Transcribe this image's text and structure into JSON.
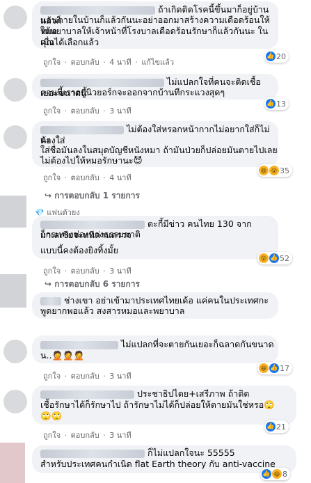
{
  "meta": {
    "like": "ถูกใจ",
    "reply": "ตอบกลับ",
    "sep": "·"
  },
  "comments": [
    {
      "text1": "ถ้าเกิดติดโรคนี้ขึ้นมาก็อยู่บ้านแล้วก็",
      "text2": "นอนตายในบ้านก็แล้วกันนะอย่าออกมาสร้างความเดือดร้อนให้หมอ",
      "text3": "ให้พยาบาลให้เจ้าหน้าที่โรงบาลเดือดร้อนรักษาก็แล้วกันนะ ในเมื่อ",
      "text4": "คุณได้เลือกแล้ว",
      "time": "4 นาที",
      "extra": "แก้ไขแล้ว",
      "count": "20"
    },
    {
      "text1": "ไม่แปลกใจที่คนจะติดเชื้อเยอะขนาดนี้",
      "text2": "ตอนนี้เราอยู่นิวยอร์กจะออกจากบ้านทีกระแวงสุดๆ",
      "time": "3 นาที",
      "count": "13"
    },
    {
      "text1": "ไม่ต้องใส่หรอกหน้ากากไม่อยากใส่ก็ไม่ต้องใส่",
      "text2": "นะ",
      "text3": "ใส่ชื่อมันลงในสมุดบัญชีหนังหมา ถ้ามันป่วยก็ปล่อยมันตายไปเลย",
      "text4": "ไม่ต้องไปให้หมอรักษานะ😈",
      "time": "4 นาที",
      "count": "35",
      "replies": "การตอบกลับ 1 รายการ"
    },
    {
      "fan": "แฟนตัวยง",
      "text1": "ตะกี้มีข่าว คนไทย 130 จากมาเลเซียจะหนีด่านตรวจ",
      "text2": "ก็กรเทางช่องทางธรรมชาติ",
      "text3": "แบบนี้คงต้องยิงทิ้งมั้ย",
      "time": "3 นาที",
      "count": "52",
      "replies": "การตอบกลับ 6 รายการ"
    },
    {
      "text1": "ช่างเขา อย่าเข้ามาประเทศไทยเด้อ แค่คนในประเทศกะ",
      "text2": "พูดยากพอแล้ว สงสารหมอและพยาบาล"
    },
    {
      "text1": "ไม่แปลกที่จะตายกันเยอะก็ฉลาดกันขนาด",
      "text2": "น..🤦🤦🤦",
      "time": "3 นาที",
      "count": "17"
    },
    {
      "text1": "ประชาธิปไตย+เสรีภาพ ถ้าติด",
      "text2": "เชื้อรักษาได้ก็รักษาไป ถ้ารักษาไม่ได้ก็ปล่อยให้ตายมันใช่หรอ🙄",
      "text3": "🙄🙄",
      "time": "3 นาที",
      "count": "21"
    },
    {
      "text1": "ก็ไม่แปลกใจนะ 55555",
      "text2": "สำหรับประเทศคนกำเนิด flat Earth theory กับ anti-vaccine",
      "count": "8"
    }
  ]
}
